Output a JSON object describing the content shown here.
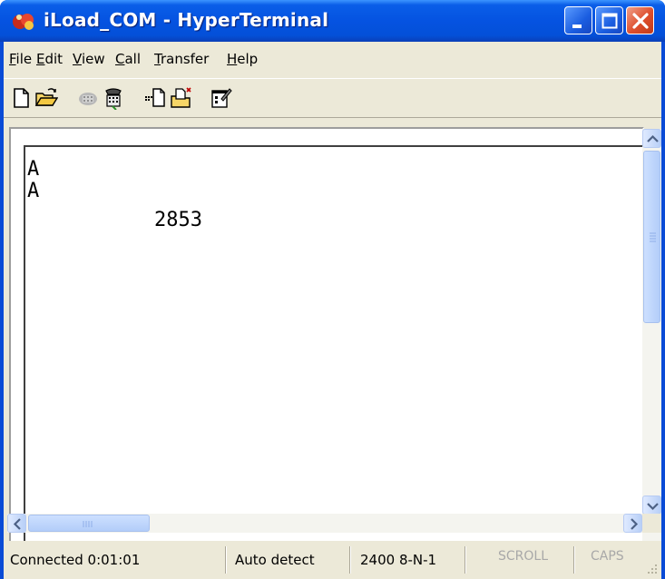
{
  "window": {
    "title": "iLoad_COM - HyperTerminal"
  },
  "menu": {
    "items": [
      {
        "label": "File",
        "key": "F",
        "rest": "ile"
      },
      {
        "label": "Edit",
        "key": "E",
        "rest": "dit"
      },
      {
        "label": "View",
        "key": "V",
        "rest": "iew"
      },
      {
        "label": "Call",
        "key": "C",
        "rest": "all"
      },
      {
        "label": "Transfer",
        "key": "T",
        "rest": "ransfer"
      },
      {
        "label": "Help",
        "key": "H",
        "rest": "elp"
      }
    ]
  },
  "toolbar": {
    "icons": [
      "new-document-icon",
      "open-folder-icon",
      "disconnect-phone-icon",
      "dial-phone-icon",
      "send-file-icon",
      "receive-file-icon",
      "properties-icon"
    ]
  },
  "terminal": {
    "lines": [
      "A",
      "A",
      "2853"
    ]
  },
  "status": {
    "connection": "Connected 0:01:01",
    "detect": "Auto detect",
    "settings": "2400 8-N-1",
    "scroll": "SCROLL",
    "caps": "CAPS"
  },
  "colors": {
    "titlebar": "#0553e1",
    "close_button": "#de4e2c",
    "client_bg": "#ece9d8"
  }
}
